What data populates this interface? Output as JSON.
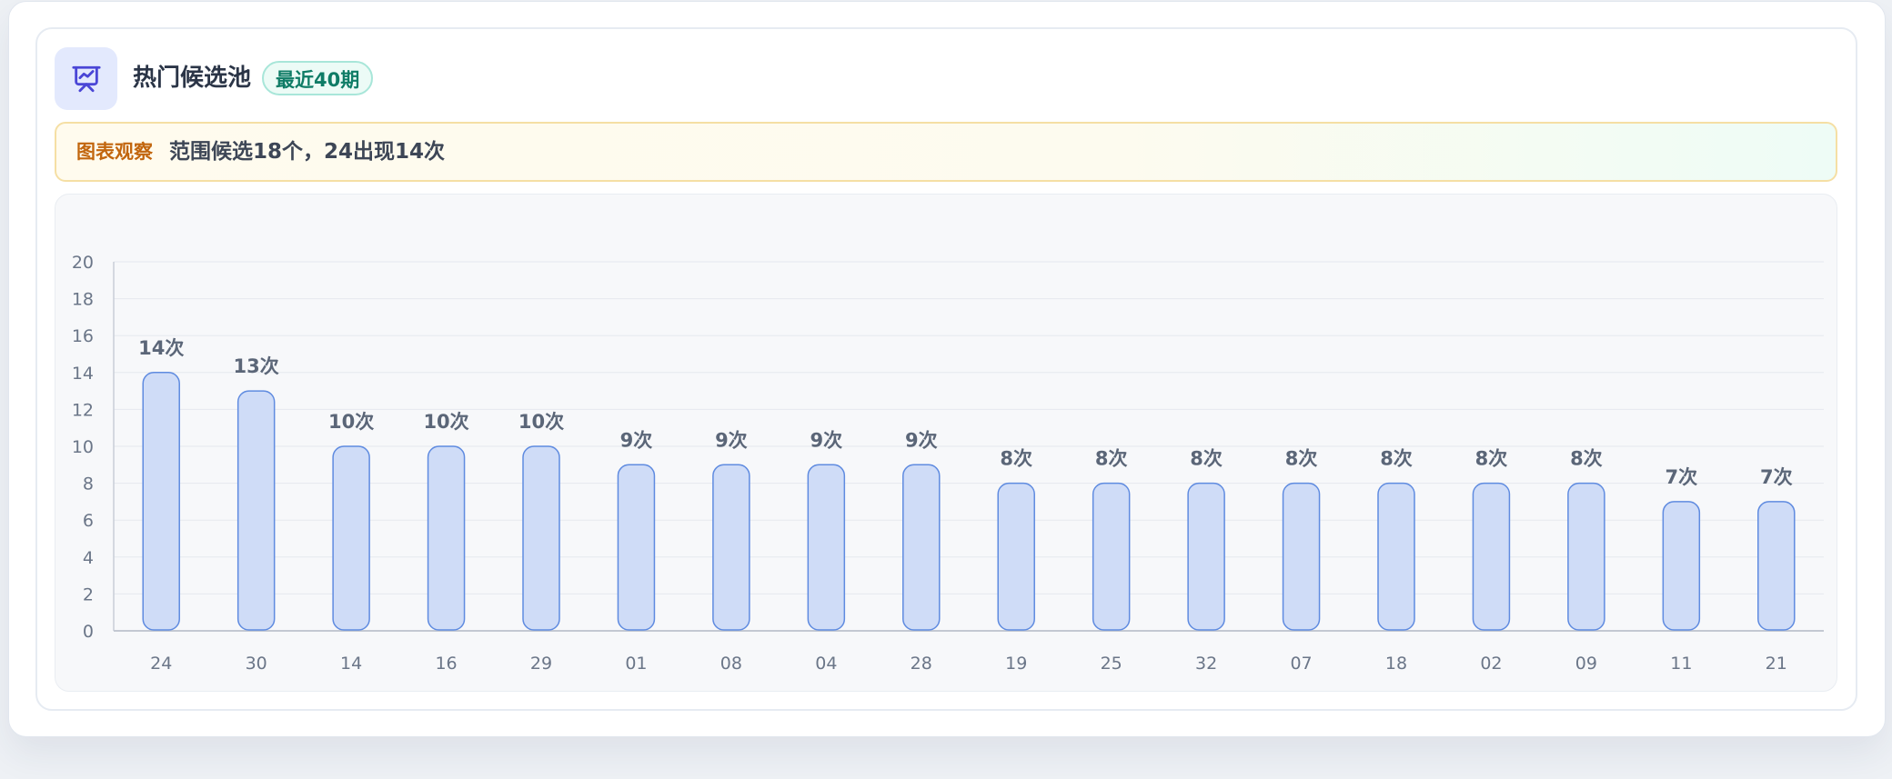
{
  "header": {
    "title": "热门候选池",
    "badge": "最近40期",
    "icon": "presentation-chart-icon"
  },
  "insight": {
    "tag": "图表观察",
    "text": "范围候选18个，24出现14次"
  },
  "colors": {
    "bar_fill": "#cfdcf7",
    "bar_stroke": "#5f8be0",
    "axis_text": "#6b7688",
    "label_text": "#5b6678",
    "grid": "#e6e9ee",
    "badge_text": "#0f7c66",
    "tag_text": "#c2660e"
  },
  "chart_data": {
    "type": "bar",
    "categories": [
      "24",
      "30",
      "14",
      "16",
      "29",
      "01",
      "08",
      "04",
      "28",
      "19",
      "25",
      "32",
      "07",
      "18",
      "02",
      "09",
      "11",
      "21"
    ],
    "values": [
      14,
      13,
      10,
      10,
      10,
      9,
      9,
      9,
      9,
      8,
      8,
      8,
      8,
      8,
      8,
      8,
      7,
      7
    ],
    "value_labels": [
      "14次",
      "13次",
      "10次",
      "10次",
      "10次",
      "9次",
      "9次",
      "9次",
      "9次",
      "8次",
      "8次",
      "8次",
      "8次",
      "8次",
      "8次",
      "8次",
      "7次",
      "7次"
    ],
    "yticks": [
      "0",
      "2",
      "4",
      "6",
      "8",
      "10",
      "12",
      "14",
      "16",
      "18",
      "20"
    ],
    "ylim": [
      0,
      20
    ],
    "title": "",
    "xlabel": "",
    "ylabel": "",
    "grid": true,
    "legend": false
  }
}
